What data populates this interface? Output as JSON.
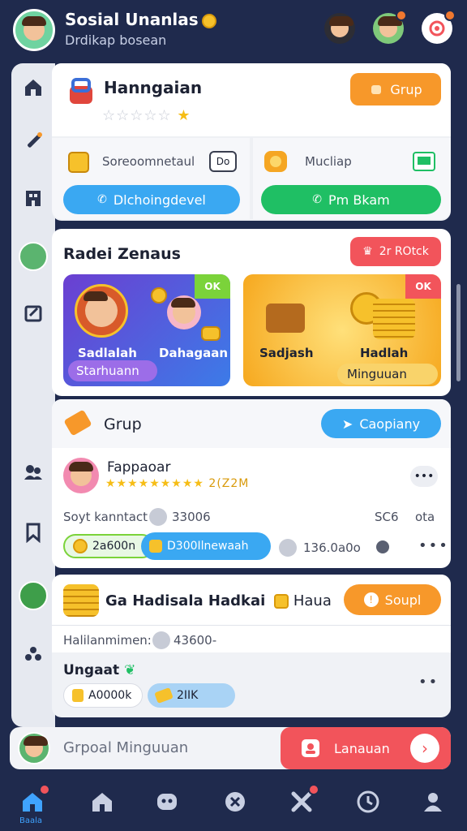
{
  "header": {
    "title": "Sosial Unanlas",
    "subtitle": "Drdikap bosean",
    "icons": [
      "avatar-dark",
      "avatar-green",
      "notification-icon"
    ]
  },
  "colors": {
    "navy": "#1f2a4d",
    "orange": "#f7982a",
    "blue": "#3aa8f2",
    "green": "#1fbf64",
    "red": "#f2545b"
  },
  "sidebar": {
    "items": [
      "home-icon",
      "wand-icon",
      "building-icon",
      "avatar",
      "edit-icon",
      "users-icon",
      "bookmark-icon",
      "avatar-green",
      "group-icon"
    ]
  },
  "card1": {
    "title": "Hanngaian",
    "rating": 1,
    "grup_btn": "Grup",
    "left_tile": {
      "label": "Soreoomnetaul",
      "tag": "Do",
      "button": "Dlchoingdevel"
    },
    "right_tile": {
      "label": "Mucliap",
      "button": "Pm Bkam"
    }
  },
  "card2": {
    "title": "Radei Zenaus",
    "badge": "2r ROtck",
    "tile_left": {
      "label_a": "Sadlalah",
      "label_b": "Starhuann",
      "label_c": "Dahagaan",
      "tag": "OK"
    },
    "tile_right": {
      "label_a": "Sadjash",
      "label_b": "Hadlah",
      "label_c": "Minguuan",
      "tag": "OK"
    }
  },
  "card3": {
    "title": "Grup",
    "button": "Caopiany",
    "user_name": "Fappaoar",
    "user_rating_text": "2(Z2M",
    "stat_label": "Soyt kanntact",
    "stat_value": "33006",
    "stat_right_a": "SC6",
    "stat_right_b": "ota",
    "chip_green": "2a600n",
    "chip_blue": "D300Ilnewaah",
    "chip_gray": "136.0a0o"
  },
  "card4": {
    "title": "Ga Hadisala Hadkai",
    "title_suffix": "Haua",
    "button": "Soupl",
    "line_label": "Halilanmimen:",
    "line_value": "43600-",
    "section": "Ungaat",
    "chip_a": "A0000k",
    "chip_b": "2IIK"
  },
  "bottom_card": {
    "label": "Grpoal Minguuan",
    "button": "Lanauan"
  },
  "bottom_nav": {
    "active_label": "Baala",
    "items": [
      "home-active",
      "home",
      "people",
      "close",
      "tools",
      "clock",
      "profile"
    ]
  }
}
